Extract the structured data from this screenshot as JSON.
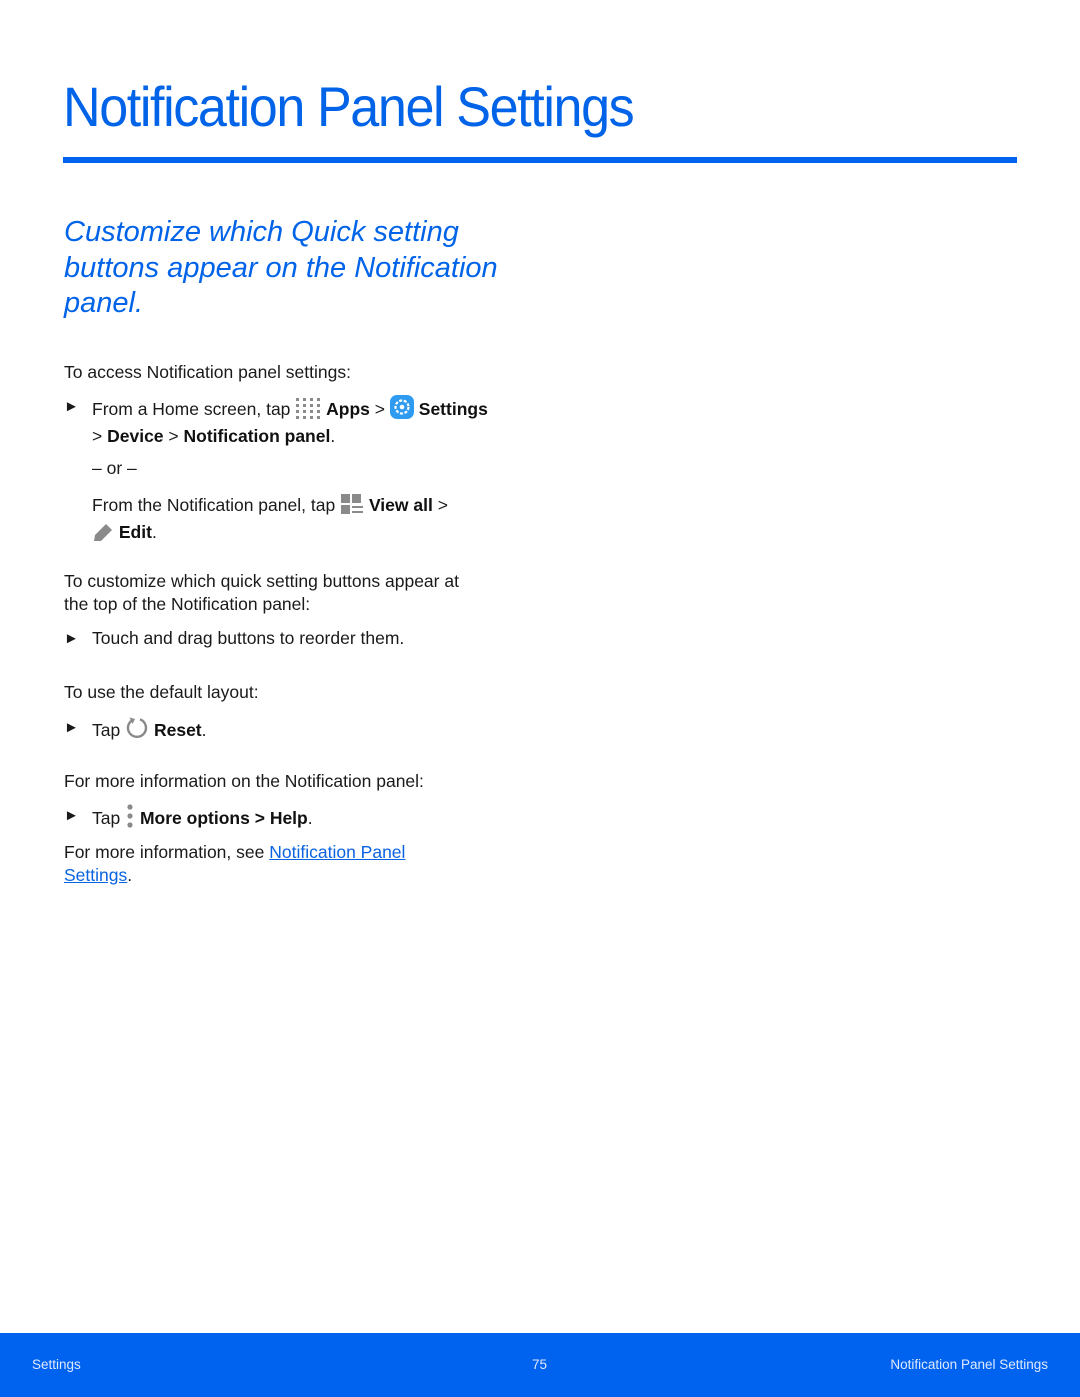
{
  "page": {
    "title": "Notification Panel Settings",
    "subtitle": "Customize which Quick setting buttons appear on the Notification panel.",
    "access_intro": "To access Notification panel settings:",
    "step1": {
      "prefix": "From a Home screen, tap",
      "apps": "Apps",
      "sep1": ">",
      "settings": "Settings",
      "line2_sep": ">",
      "device": "Device",
      "sep2": ">",
      "notification_panel": "Notification panel",
      "end": "."
    },
    "or_text": "– or –",
    "alt": {
      "prefix": "From the Notification panel, tap",
      "view_all": "View all",
      "sep": ">",
      "edit": "Edit",
      "end": "."
    },
    "customize_intro_1": "To customize which quick setting buttons appear at",
    "customize_intro_2": "the top of the Notification panel:",
    "drag_step": "Touch and drag buttons to reorder them.",
    "default_intro": "To use the default layout:",
    "reset_step": {
      "prefix": "Tap",
      "reset": "Reset",
      "end": "."
    },
    "more_info_intro": "For more information on the Notification panel:",
    "help_step": {
      "prefix": "Tap",
      "more_options": "More options",
      "sep": ">",
      "help": "Help",
      "end": "."
    },
    "see_also": {
      "prefix": "For more information, see",
      "link_line1": "Notification Panel",
      "link_line2": "Settings",
      "end": "."
    }
  },
  "icons": {
    "bullet": "►",
    "apps": "apps-grid-icon",
    "settings": "settings-gear-icon",
    "view_all": "view-all-icon",
    "edit": "pencil-icon",
    "reset": "reset-icon",
    "more_options": "more-options-icon"
  },
  "footer": {
    "left": "Settings",
    "page_number": "75",
    "right": "Notification Panel Settings"
  },
  "colors": {
    "accent": "#0063ef",
    "heading": "#0063e8",
    "text": "#1a1a1a",
    "link": "#0a63e0",
    "icon_gray": "#8a8a8a"
  }
}
